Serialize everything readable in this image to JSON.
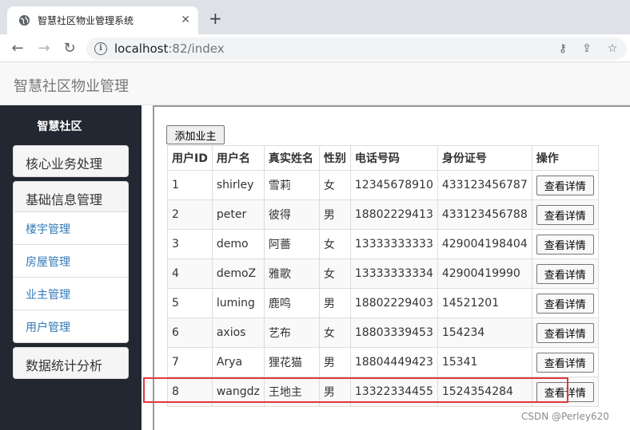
{
  "browser": {
    "tab_title": "智慧社区物业管理系统",
    "url_host": "localhost",
    "url_rest": ":82/index"
  },
  "app": {
    "brand": "智慧社区物业管理"
  },
  "sidebar": {
    "title": "智慧社区",
    "core": "核心业务处理",
    "base": "基础信息管理",
    "base_items": [
      "楼宇管理",
      "房屋管理",
      "业主管理",
      "用户管理"
    ],
    "stats": "数据统计分析"
  },
  "main": {
    "add_button": "添加业主",
    "columns": [
      "用户ID",
      "用户名",
      "真实姓名",
      "性别",
      "电话号码",
      "身份证号",
      "操作"
    ],
    "detail_label": "查看详情",
    "rows": [
      [
        "1",
        "shirley",
        "雪莉",
        "女",
        "12345678910",
        "433123456787"
      ],
      [
        "2",
        "peter",
        "彼得",
        "男",
        "18802229413",
        "433123456788"
      ],
      [
        "3",
        "demo",
        "阿薔",
        "女",
        "13333333333",
        "429004198404"
      ],
      [
        "4",
        "demoZ",
        "雅歌",
        "女",
        "13333333334",
        "42900419990"
      ],
      [
        "5",
        "luming",
        "鹿鸣",
        "男",
        "18802229403",
        "14521201"
      ],
      [
        "6",
        "axios",
        "艺布",
        "女",
        "18803339453",
        "154234"
      ],
      [
        "7",
        "Arya",
        "狸花猫",
        "男",
        "18804449423",
        "15341"
      ],
      [
        "8",
        "wangdz",
        "王地主",
        "男",
        "13322334455",
        "1524354284"
      ]
    ]
  },
  "watermark": "CSDN @Perley620",
  "colors": {
    "highlight": "#e0383a",
    "sidebar_bg": "#222831",
    "link": "#337ab7"
  }
}
